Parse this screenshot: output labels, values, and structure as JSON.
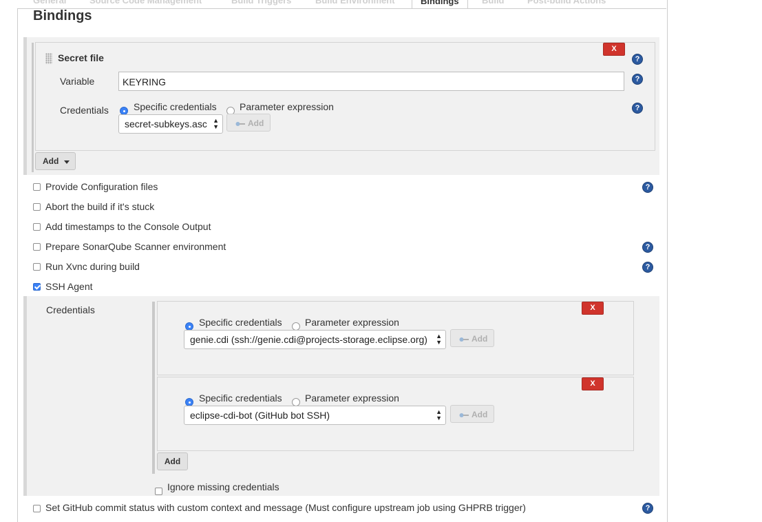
{
  "tabs": [
    "General",
    "Source Code Management",
    "Build Triggers",
    "Build Environment",
    "Bindings",
    "Build",
    "Post-build Actions"
  ],
  "active_tab": "Bindings",
  "section_title": "Bindings",
  "secret_file": {
    "title": "Secret file",
    "delete_label": "X",
    "variable_label": "Variable",
    "variable_value": "KEYRING",
    "credentials_label": "Credentials",
    "radio_specific": "Specific credentials",
    "radio_parameter": "Parameter expression",
    "selected_credential": "secret-subkeys.asc",
    "add_label": "Add"
  },
  "add_binding_label": "Add",
  "options": [
    {
      "label": "Provide Configuration files",
      "checked": false,
      "help": true
    },
    {
      "label": "Abort the build if it's stuck",
      "checked": false,
      "help": false
    },
    {
      "label": "Add timestamps to the Console Output",
      "checked": false,
      "help": false
    },
    {
      "label": "Prepare SonarQube Scanner environment",
      "checked": false,
      "help": true
    },
    {
      "label": "Run Xvnc during build",
      "checked": false,
      "help": true
    },
    {
      "label": "SSH Agent",
      "checked": true,
      "help": false
    }
  ],
  "ssh_agent": {
    "credentials_label": "Credentials",
    "entries": [
      {
        "radio_specific": "Specific credentials",
        "radio_parameter": "Parameter expression",
        "selected": "genie.cdi (ssh://genie.cdi@projects-storage.eclipse.org)",
        "add_label": "Add",
        "delete_label": "X"
      },
      {
        "radio_specific": "Specific credentials",
        "radio_parameter": "Parameter expression",
        "selected": "eclipse-cdi-bot (GitHub bot SSH)",
        "add_label": "Add",
        "delete_label": "X"
      }
    ],
    "add_label": "Add",
    "ignore_missing_label": "Ignore missing credentials"
  },
  "last_option": {
    "label": "Set GitHub commit status with custom context and message (Must configure upstream job using GHPRB trigger)",
    "checked": false
  },
  "help_glyph": "?",
  "colors": {
    "accent": "#3b82f6",
    "delete": "#d0342c",
    "help": "#2c5aa0",
    "panel": "#f1f1f1"
  }
}
